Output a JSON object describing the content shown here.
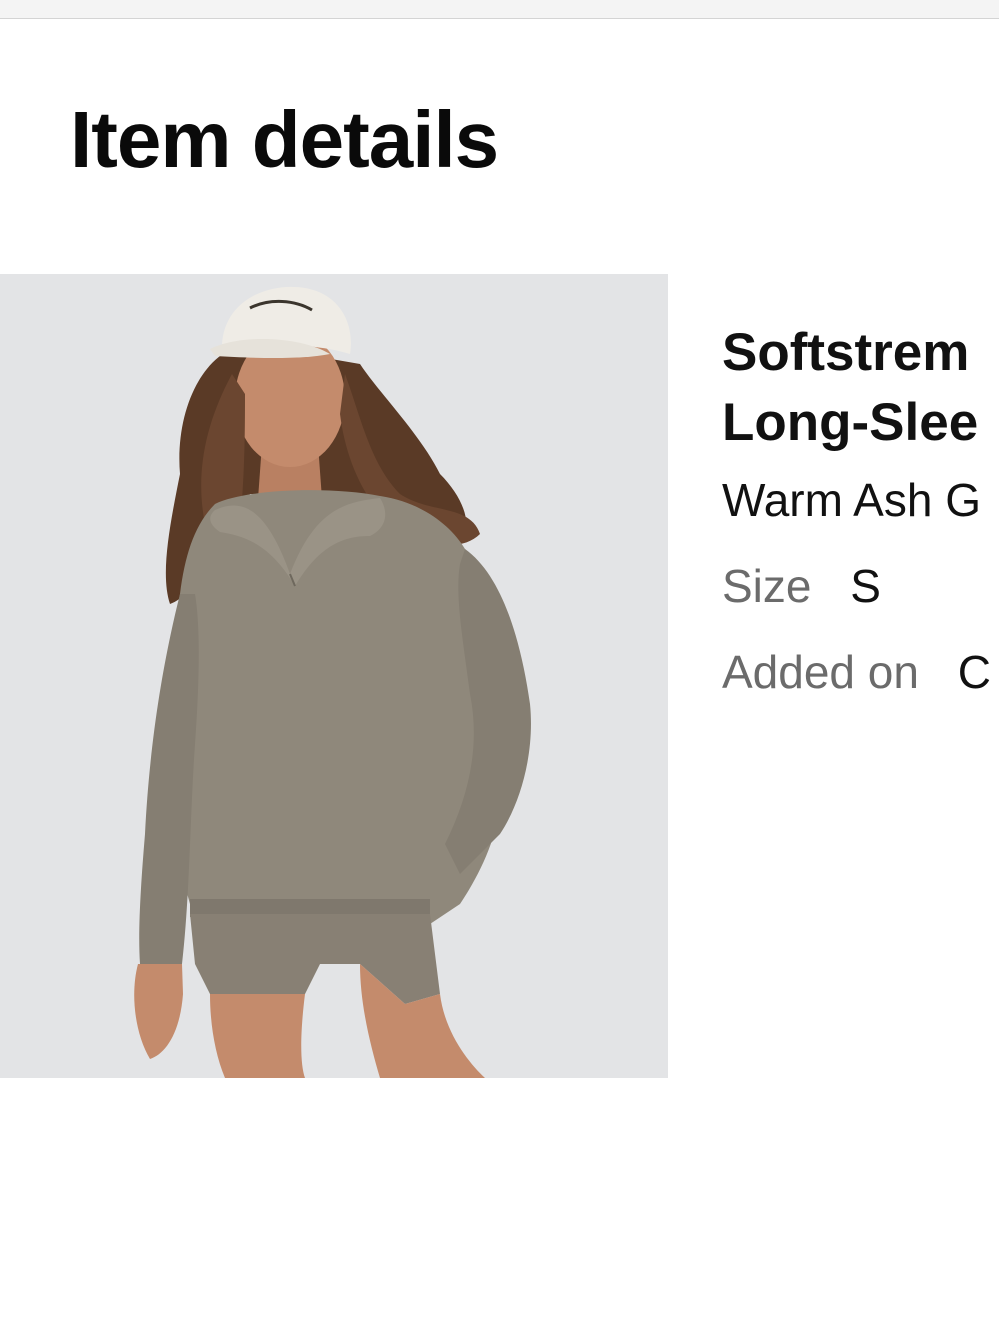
{
  "header": {
    "title": "Item details"
  },
  "product": {
    "image_alt": "Model wearing the item",
    "name_line1": "Softstrem",
    "name_line2": "Long-Slee",
    "color": "Warm Ash G",
    "size_label": "Size",
    "size_value": "S",
    "added_label": "Added on",
    "added_value": "C"
  },
  "colors": {
    "image_background": "#e3e4e6",
    "garment": "#8f887b",
    "label_gray": "#6b6b6b"
  }
}
